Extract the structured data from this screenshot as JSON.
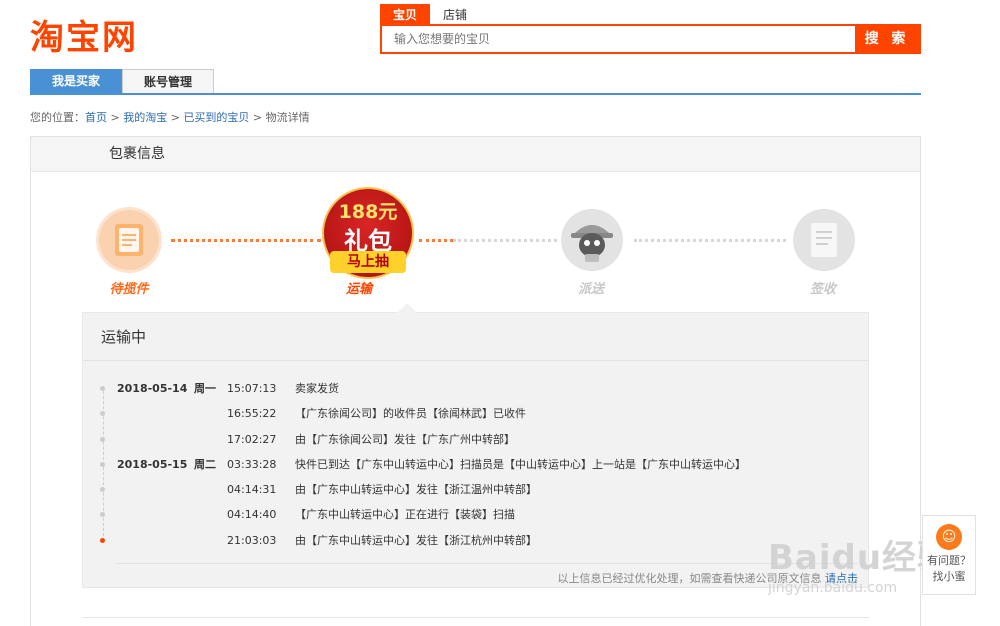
{
  "logo": {
    "text": "淘宝网"
  },
  "search": {
    "tabs": [
      "宝贝",
      "店铺"
    ],
    "placeholder": "输入您想要的宝贝",
    "button": "搜 索"
  },
  "nav": {
    "tabs": [
      "我是买家",
      "账号管理"
    ]
  },
  "breadcrumb": {
    "prefix": "您的位置：",
    "links": [
      "首页",
      "我的淘宝",
      "已买到的宝贝"
    ],
    "current": "物流详情",
    "sep": " > "
  },
  "panel": {
    "title": "包裹信息"
  },
  "steps": [
    {
      "label": "待揽件",
      "state": "done"
    },
    {
      "label": "运输",
      "state": "current"
    },
    {
      "label": "派送",
      "state": "pending"
    },
    {
      "label": "签收",
      "state": "pending"
    }
  ],
  "promo": {
    "amount": "188元",
    "gift": "礼包",
    "action": "马上抽"
  },
  "detail": {
    "status": "运输中",
    "events": [
      {
        "date": "2018-05-14",
        "weekday": "周一",
        "time": "15:07:13",
        "desc": "卖家发货"
      },
      {
        "date": "",
        "weekday": "",
        "time": "16:55:22",
        "desc": "【广东徐闻公司】的收件员【徐闻林武】已收件"
      },
      {
        "date": "",
        "weekday": "",
        "time": "17:02:27",
        "desc": "由【广东徐闻公司】发往【广东广州中转部】"
      },
      {
        "date": "2018-05-15",
        "weekday": "周二",
        "time": "03:33:28",
        "desc": "快件已到达【广东中山转运中心】扫描员是【中山转运中心】上一站是【广东中山转运中心】"
      },
      {
        "date": "",
        "weekday": "",
        "time": "04:14:31",
        "desc": "由【广东中山转运中心】发往【浙江温州中转部】"
      },
      {
        "date": "",
        "weekday": "",
        "time": "04:14:40",
        "desc": "【广东中山转运中心】正在进行【装袋】扫描"
      },
      {
        "date": "",
        "weekday": "",
        "time": "21:03:03",
        "desc": "由【广东中山转运中心】发往【浙江杭州中转部】"
      }
    ],
    "note": "以上信息已经过优化处理，如需查看快递公司原文信息",
    "note_link": "请点击"
  },
  "helper": {
    "line1": "有问题？",
    "line2": "找小蜜"
  },
  "watermark": {
    "big": "Baidu经验",
    "small": "jingyan.baidu.com"
  },
  "colors": {
    "brand": "#ff4400",
    "link": "#2b6bb0",
    "nav": "#4a90d4"
  }
}
